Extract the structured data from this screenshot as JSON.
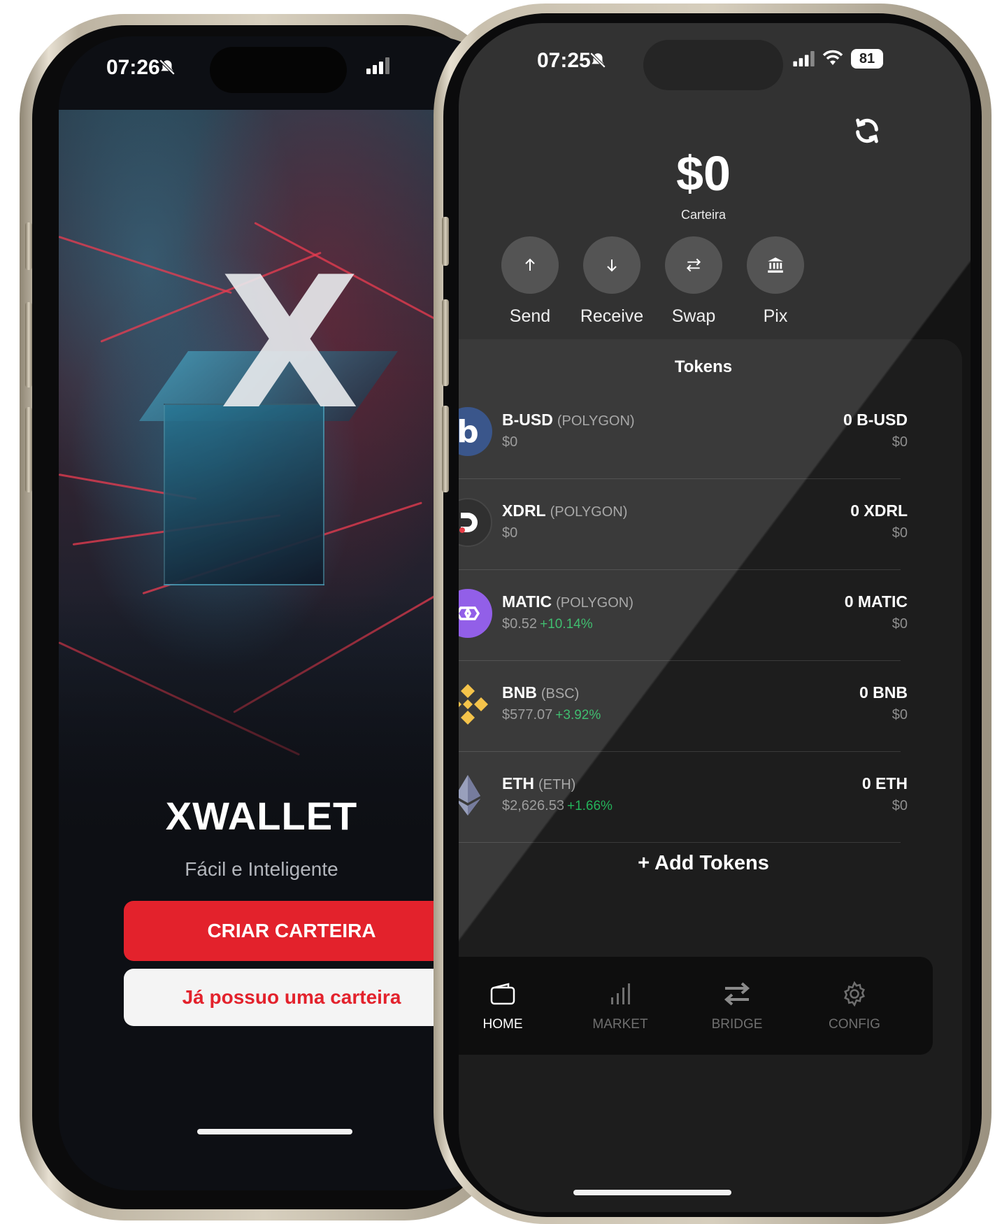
{
  "left_phone": {
    "status_time": "07:26",
    "logo_letter": "X",
    "app_name": "XWALLET",
    "tagline": "Fácil e Inteligente",
    "create_button": "CRIAR CARTEIRA",
    "login_button": "Já possuo uma carteira"
  },
  "right_phone": {
    "status_time": "07:25",
    "battery": "81",
    "balance": "$0",
    "balance_label": "Carteira",
    "actions": [
      {
        "label": "Send",
        "icon": "arrow-up-icon"
      },
      {
        "label": "Receive",
        "icon": "arrow-down-icon"
      },
      {
        "label": "Swap",
        "icon": "swap-icon"
      },
      {
        "label": "Pix",
        "icon": "bank-icon"
      }
    ],
    "tokens_title": "Tokens",
    "tokens": [
      {
        "symbol": "B-USD",
        "chain": "(POLYGON)",
        "price": "$0",
        "change": "",
        "balance": "0 B-USD",
        "usd": "$0",
        "icon_color": "#1d3d7a"
      },
      {
        "symbol": "XDRL",
        "chain": "(POLYGON)",
        "price": "$0",
        "change": "",
        "balance": "0 XDRL",
        "usd": "$0",
        "icon_color": "#111111"
      },
      {
        "symbol": "MATIC",
        "chain": "(POLYGON)",
        "price": "$0.52",
        "change": "+10.14%",
        "balance": "0 MATIC",
        "usd": "$0",
        "icon_color": "#8247e5"
      },
      {
        "symbol": "BNB",
        "chain": "(BSC)",
        "price": "$577.07",
        "change": "+3.92%",
        "balance": "0 BNB",
        "usd": "$0",
        "icon_color": "#f3ba2f"
      },
      {
        "symbol": "ETH",
        "chain": "(ETH)",
        "price": "$2,626.53",
        "change": "+1.66%",
        "balance": "0 ETH",
        "usd": "$0",
        "icon_color": "#627eea"
      }
    ],
    "add_tokens": "+ Add Tokens",
    "tabs": [
      {
        "label": "HOME",
        "icon": "wallet-icon",
        "active": true
      },
      {
        "label": "MARKET",
        "icon": "bar-chart-icon",
        "active": false
      },
      {
        "label": "BRIDGE",
        "icon": "transfer-icon",
        "active": false
      },
      {
        "label": "CONFIG",
        "icon": "gear-icon",
        "active": false
      }
    ]
  },
  "colors": {
    "accent_red": "#e3222c",
    "positive": "#24b35a"
  }
}
